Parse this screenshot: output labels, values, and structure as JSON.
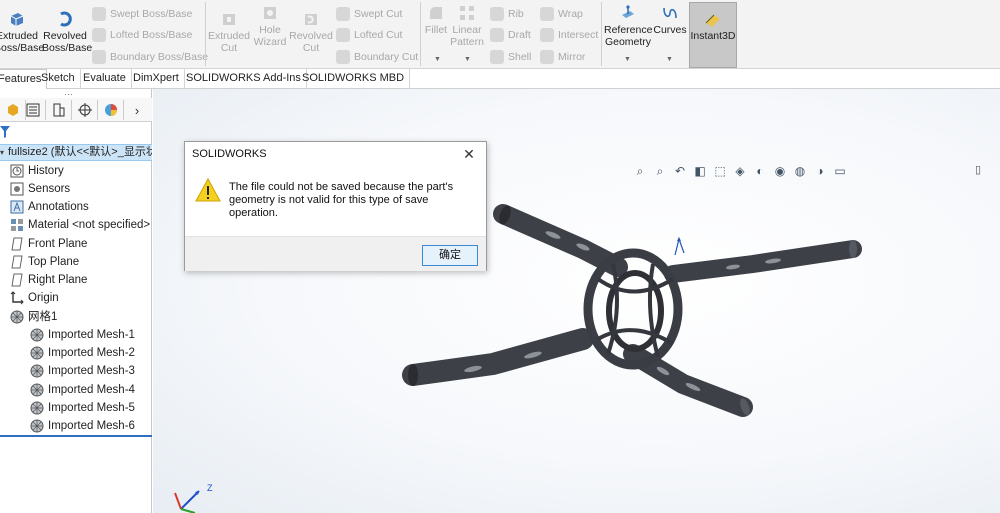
{
  "ribbon": {
    "extruded_boss_line1": "Extruded",
    "extruded_boss_line2": "Boss/Base",
    "revolved_boss_line1": "Revolved",
    "revolved_boss_line2": "Boss/Base",
    "swept_boss": "Swept Boss/Base",
    "lofted_boss": "Lofted Boss/Base",
    "boundary_boss": "Boundary Boss/Base",
    "extruded_cut_line1": "Extruded",
    "extruded_cut_line2": "Cut",
    "hole_wizard_line1": "Hole",
    "hole_wizard_line2": "Wizard",
    "revolved_cut_line1": "Revolved",
    "revolved_cut_line2": "Cut",
    "swept_cut": "Swept Cut",
    "lofted_cut": "Lofted Cut",
    "boundary_cut": "Boundary Cut",
    "fillet": "Fillet",
    "linear_pattern_line1": "Linear",
    "linear_pattern_line2": "Pattern",
    "rib": "Rib",
    "draft": "Draft",
    "shell": "Shell",
    "wrap": "Wrap",
    "intersect": "Intersect",
    "mirror": "Mirror",
    "reference_geometry_line1": "Reference",
    "reference_geometry_line2": "Geometry",
    "curves": "Curves",
    "instant3d": "Instant3D"
  },
  "tabs": [
    "Features",
    "Sketch",
    "Evaluate",
    "DimXpert",
    "SOLIDWORKS Add-Ins",
    "SOLIDWORKS MBD"
  ],
  "tree": {
    "root": "fullsize2 (默认<<默认>_显示状",
    "items": [
      {
        "label": "History",
        "icon": "history-icon"
      },
      {
        "label": "Sensors",
        "icon": "sensors-icon"
      },
      {
        "label": "Annotations",
        "icon": "annotations-icon"
      },
      {
        "label": "Material <not specified>",
        "icon": "material-icon"
      },
      {
        "label": "Front Plane",
        "icon": "plane-icon"
      },
      {
        "label": "Top Plane",
        "icon": "plane-icon"
      },
      {
        "label": "Right Plane",
        "icon": "plane-icon"
      },
      {
        "label": "Origin",
        "icon": "origin-icon"
      },
      {
        "label": "网格1",
        "icon": "mesh-folder-icon"
      }
    ],
    "meshes": [
      "Imported Mesh-1",
      "Imported Mesh-2",
      "Imported Mesh-3",
      "Imported Mesh-4",
      "Imported Mesh-5",
      "Imported Mesh-6"
    ]
  },
  "dialog": {
    "title": "SOLIDWORKS",
    "message": "The file could not be saved because the part's geometry is not valid for this type of save operation.",
    "ok_label": "确定",
    "icon": "warning-icon"
  },
  "viewport": {
    "triad_z_label": "Z",
    "background_color": "#f3f6fa",
    "model_color": "#3e4148"
  }
}
